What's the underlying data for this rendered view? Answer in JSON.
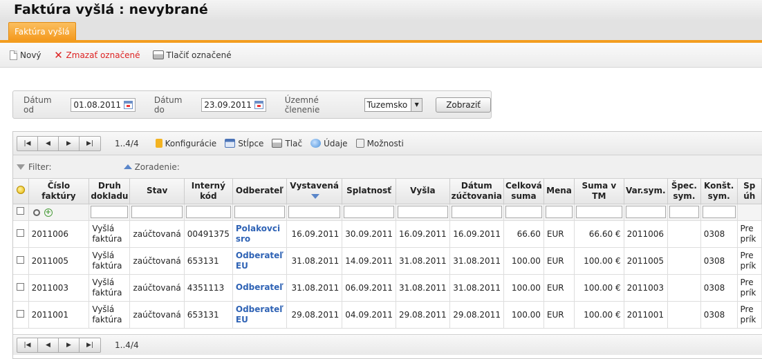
{
  "title": "Faktúra vyšlá :  nevybrané",
  "tab": "Faktúra vyšlá",
  "toolbar": {
    "new": "Nový",
    "delete": "Zmazať označené",
    "print": "Tlačiť označené"
  },
  "filter": {
    "date_from_label": "Dátum od",
    "date_from": "01.08.2011",
    "date_to_label": "Dátum do",
    "date_to": "23.09.2011",
    "territory_label": "Územné členenie",
    "territory": "Tuzemsko",
    "show_button": "Zobraziť"
  },
  "grid": {
    "range": "1..4/4",
    "tools": {
      "config": "Konfigurácie",
      "columns": "Stĺpce",
      "print": "Tlač",
      "data": "Údaje",
      "options": "Možnosti"
    },
    "filter_label": "Filter:",
    "sort_label": "Zoradenie:",
    "columns": [
      "Číslo faktúry",
      "Druh dokladu",
      "Stav",
      "Interný kód",
      "Odberateľ",
      "Vystavená",
      "Splatnosť",
      "Vyšla",
      "Dátum zúčtovania",
      "Celková suma",
      "Mena",
      "Suma v TM",
      "Var.sym.",
      "Špec. sym.",
      "Konšt. sym.",
      "Sp úh"
    ],
    "rows": [
      {
        "number": "2011006",
        "type": "Vyšlá faktúra",
        "state": "zaúčtovaná",
        "code": "00491375",
        "customer": "Polakovci sro",
        "issued": "16.09.2011",
        "due": "30.09.2011",
        "sent": "16.09.2011",
        "posted": "16.09.2011",
        "total": "66.60",
        "currency": "EUR",
        "total_tm": "66.60 €",
        "var": "2011006",
        "spec": "",
        "const": "0308",
        "pay": "Pre prík"
      },
      {
        "number": "2011005",
        "type": "Vyšlá faktúra",
        "state": "zaúčtovaná",
        "code": "653131",
        "customer": "Odberateľ EU",
        "issued": "31.08.2011",
        "due": "14.09.2011",
        "sent": "31.08.2011",
        "posted": "31.08.2011",
        "total": "100.00",
        "currency": "EUR",
        "total_tm": "100.00 €",
        "var": "2011005",
        "spec": "",
        "const": "0308",
        "pay": "Pre prík"
      },
      {
        "number": "2011003",
        "type": "Vyšlá faktúra",
        "state": "zaúčtovaná",
        "code": "4351113",
        "customer": "Odberateľ",
        "issued": "31.08.2011",
        "due": "06.09.2011",
        "sent": "31.08.2011",
        "posted": "31.08.2011",
        "total": "100.00",
        "currency": "EUR",
        "total_tm": "100.00 €",
        "var": "2011003",
        "spec": "",
        "const": "0308",
        "pay": "Pre prík"
      },
      {
        "number": "2011001",
        "type": "Vyšlá faktúra",
        "state": "zaúčtovaná",
        "code": "653131",
        "customer": "Odberateľ EU",
        "issued": "29.08.2011",
        "due": "04.09.2011",
        "sent": "29.08.2011",
        "posted": "29.08.2011",
        "total": "100.00",
        "currency": "EUR",
        "total_tm": "100.00 €",
        "var": "2011001",
        "spec": "",
        "const": "0308",
        "pay": "Pre prík"
      }
    ]
  }
}
